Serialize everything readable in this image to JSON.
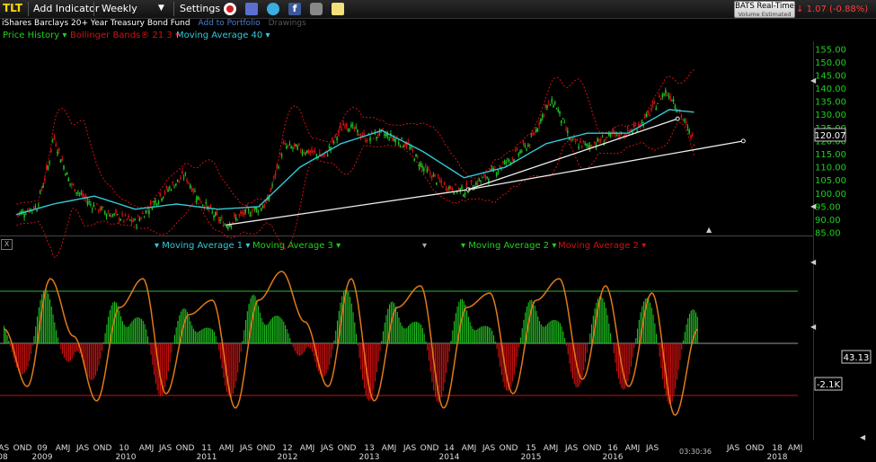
{
  "toolbar": {
    "symbol": "TLT",
    "add_indicator": "Add Indicator",
    "period": "Weekly",
    "settings": "Settings"
  },
  "header": {
    "fund_name": "iShares Barclays 20+ Year Treasury Bond Fund",
    "add_to_portfolio": "Add to Portfolio",
    "drawings": "Drawings",
    "bats_line1": "BATS Real-Time",
    "bats_line2": "Volume Estimated",
    "change": "1.07 (-0.88%)"
  },
  "legend": {
    "price": "Price History",
    "bollinger": "Bollinger Bands® 21 3",
    "ma": "Moving Average 40"
  },
  "indicator_legend": {
    "ma1": "Moving Average 1",
    "ma3": "Moving Average 3",
    "ma2_green": "Moving Average 2",
    "ma2_red": "Moving Average 2"
  },
  "readouts": {
    "last_price": "120.07",
    "ind_high": "43.13",
    "ind_low": "-2.1K",
    "time": "03:30:36"
  },
  "colors": {
    "up": "#1fbf1f",
    "down": "#d01010",
    "ma": "#35c8d8",
    "band": "#d01010",
    "osc": "#e07a1a",
    "ref_line": "#2db52d",
    "low_line": "#c01818"
  },
  "chart_data": [
    {
      "type": "line",
      "title": "",
      "y_ticks": [
        "155.00",
        "150.00",
        "145.00",
        "140.00",
        "135.00",
        "130.00",
        "125.00",
        "120.00",
        "115.00",
        "110.00",
        "105.00",
        "100.00",
        "95.00",
        "90.00",
        "85.00"
      ],
      "ylim": [
        84,
        158
      ],
      "x_year_labels": [
        "09",
        "10",
        "11",
        "12",
        "13",
        "14",
        "15",
        "16",
        "18"
      ],
      "x_labels_row1": [
        "JAS",
        "OND",
        "09",
        "AMJ",
        "JAS",
        "OND",
        "10",
        "AMJ",
        "JAS",
        "OND",
        "11",
        "AMJ",
        "JAS",
        "OND",
        "12",
        "AMJ",
        "JAS",
        "OND",
        "13",
        "AMJ",
        "JAS",
        "OND",
        "14",
        "AMJ",
        "JAS",
        "OND",
        "15",
        "AMJ",
        "JAS",
        "OND",
        "16",
        "AMJ",
        "JAS",
        "JAS",
        "OND",
        "18",
        "AMJ"
      ],
      "x_labels_row2": [
        "08",
        "2009",
        "2010",
        "2011",
        "2012",
        "2013",
        "2014",
        "2015",
        "2016",
        "2018"
      ],
      "series": [
        {
          "name": "Price History",
          "x": [
            2008.55,
            2008.8,
            2008.95,
            2009.0,
            2009.2,
            2009.45,
            2009.7,
            2010.0,
            2010.3,
            2010.6,
            2010.75,
            2010.95,
            2011.1,
            2011.3,
            2011.6,
            2011.8,
            2012.0,
            2012.3,
            2012.55,
            2012.8,
            2013.0,
            2013.3,
            2013.5,
            2013.75,
            2014.0,
            2014.3,
            2014.6,
            2014.8,
            2015.0,
            2015.1,
            2015.3,
            2015.5,
            2015.8,
            2016.0,
            2016.2,
            2016.45,
            2016.55,
            2016.7,
            2016.8
          ],
          "values": [
            92,
            95,
            112,
            122,
            104,
            96,
            92,
            89,
            99,
            107,
            99,
            92,
            88,
            92,
            96,
            118,
            117,
            114,
            127,
            121,
            123,
            119,
            110,
            103,
            101,
            107,
            114,
            119,
            133,
            135,
            120,
            118,
            122,
            123,
            128,
            139,
            136,
            126,
            120
          ]
        },
        {
          "name": "Moving Average 40",
          "x": [
            2008.55,
            2009.0,
            2009.5,
            2010.0,
            2010.5,
            2011.0,
            2011.5,
            2012.0,
            2012.5,
            2013.0,
            2013.5,
            2014.0,
            2014.5,
            2015.0,
            2015.5,
            2016.0,
            2016.5,
            2016.8
          ],
          "values": [
            92,
            96,
            99,
            94,
            96,
            94,
            95,
            110,
            119,
            124,
            116,
            106,
            110,
            119,
            123,
            123,
            132,
            131
          ]
        }
      ],
      "trendlines": [
        {
          "from": [
            2011.1,
            88
          ],
          "to": [
            2014.05,
            101.5
          ]
        },
        {
          "from": [
            2014.05,
            101.5
          ],
          "to": [
            2016.6,
            128.5
          ]
        },
        {
          "from": [
            2014.05,
            101.5
          ],
          "to": [
            2017.4,
            120
          ]
        }
      ]
    },
    {
      "type": "bar",
      "title": "",
      "reference_levels": [
        43.13,
        0,
        -2100
      ],
      "series": [
        {
          "name": "Moving Average 1",
          "values": [
            0.2,
            -0.6,
            0.9,
            0.1,
            -0.8,
            0.5,
            0.9,
            -0.7,
            0.4,
            0.6,
            -0.9,
            0.6,
            1.0,
            0.3,
            -0.6,
            0.9,
            -0.8,
            0.5,
            0.8,
            -0.9,
            0.5,
            0.7,
            -0.7,
            0.6,
            0.9,
            -0.5,
            0.8,
            -0.6,
            0.7,
            -1.0,
            0.2
          ]
        }
      ]
    }
  ]
}
